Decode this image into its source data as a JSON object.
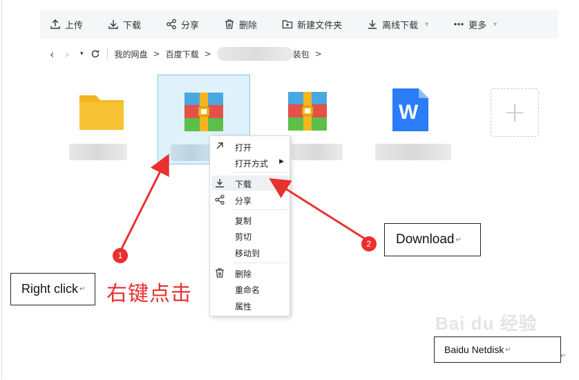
{
  "toolbar": {
    "upload": "上传",
    "download": "下载",
    "share": "分享",
    "delete": "删除",
    "new_folder": "新建文件夹",
    "offline_download": "离线下载",
    "more": "更多"
  },
  "breadcrumb": {
    "root": "我的网盘",
    "level1": "百度下载",
    "current_suffix": "装包",
    "gt": ">"
  },
  "files": {
    "folder_icon": "folder-icon",
    "archive_icon": "winrar-archive-icon",
    "word_icon": "word-document-icon",
    "word_letter": "W",
    "add_label": "+"
  },
  "context_menu": {
    "open": "打开",
    "open_with": "打开方式",
    "download": "下载",
    "share": "分享",
    "copy": "复制",
    "cut": "剪切",
    "move_to": "移动到",
    "delete": "删除",
    "rename": "重命名",
    "properties": "属性"
  },
  "annotations": {
    "badge1": "1",
    "badge2": "2",
    "right_click_en": "Right click",
    "right_click_cn": "右键点击",
    "download_en": "Download",
    "netdisk_label": "Baidu Netdisk",
    "return_mark": "↵",
    "watermark": "Bai du 经验"
  },
  "colors": {
    "accent_red": "#e8302f",
    "selection_bg": "#dff1fb",
    "selection_border": "#7cc7ee",
    "folder_yellow": "#f7c233",
    "word_blue": "#2b7cf6"
  }
}
